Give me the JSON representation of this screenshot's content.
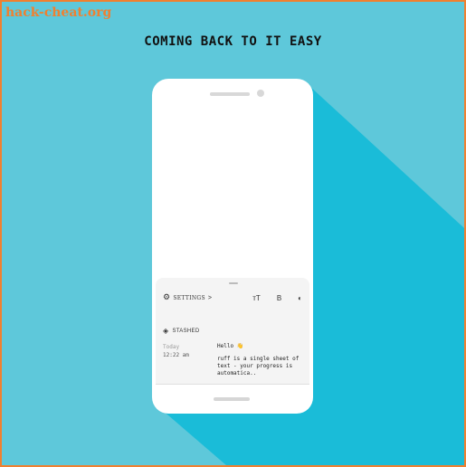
{
  "watermark": "hack-cheat.org",
  "headline": "COMING BACK TO IT EASY",
  "colors": {
    "background": "#5ec8da",
    "shadow": "#1abcd8",
    "border": "#f08030"
  },
  "app": {
    "toolbar": {
      "settings_label": "SETTINGS",
      "settings_chevron": ">",
      "font_size_icon": "тT",
      "bold_icon": "B",
      "contrast_icon": "◐"
    },
    "stashed": {
      "label": "STASHED",
      "items": [
        {
          "date": "Today",
          "time": "12:22 am",
          "title": "Hello 👋",
          "preview": "ruff is a single sheet of text - your progress is automatica.."
        }
      ]
    }
  }
}
